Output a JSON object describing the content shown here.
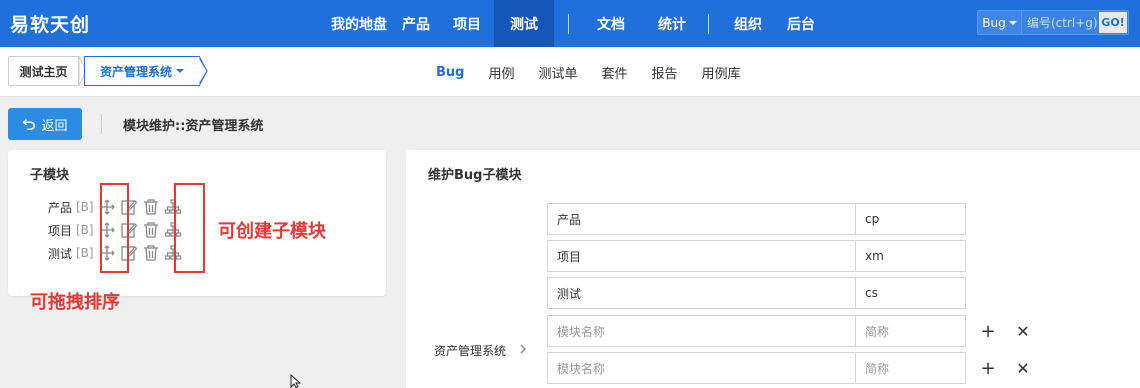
{
  "app": {
    "logo": "易软天创"
  },
  "topnav": {
    "items": [
      "我的地盘",
      "产品",
      "项目",
      "测试",
      "文档",
      "统计",
      "组织",
      "后台"
    ],
    "active": "测试"
  },
  "search": {
    "type": "Bug",
    "placeholder": "编号(ctrl+g)",
    "go": "GO!"
  },
  "breadcrumb": {
    "home": "测试主页",
    "current": "资产管理系统"
  },
  "subnav": {
    "items": [
      "Bug",
      "用例",
      "测试单",
      "套件",
      "报告",
      "用例库"
    ],
    "active": "Bug"
  },
  "toolbar": {
    "back_label": "返回",
    "heading": "模块维护::资产管理系统"
  },
  "left_panel": {
    "title": "子模块",
    "modules": [
      {
        "name": "产品",
        "tag": "[B]"
      },
      {
        "name": "项目",
        "tag": "[B]"
      },
      {
        "name": "测试",
        "tag": "[B]"
      }
    ],
    "annotation_drag": "可拖拽排序",
    "annotation_create": "可创建子模块",
    "icons": [
      "move-icon",
      "edit-icon",
      "delete-icon",
      "sitemap-icon"
    ]
  },
  "right_panel": {
    "title": "维护Bug子模块",
    "parent_label": "资产管理系统",
    "rows": [
      {
        "name": "产品",
        "short": "cp"
      },
      {
        "name": "项目",
        "short": "xm"
      },
      {
        "name": "测试",
        "short": "cs"
      }
    ],
    "new_row_placeholders": {
      "name": "模块名称",
      "short": "简称"
    },
    "add_symbol": "+",
    "remove_symbol": "✕"
  },
  "colors": {
    "primary": "#1f6fdc",
    "annotation": "#e53935",
    "back_button": "#2b8ce4"
  }
}
